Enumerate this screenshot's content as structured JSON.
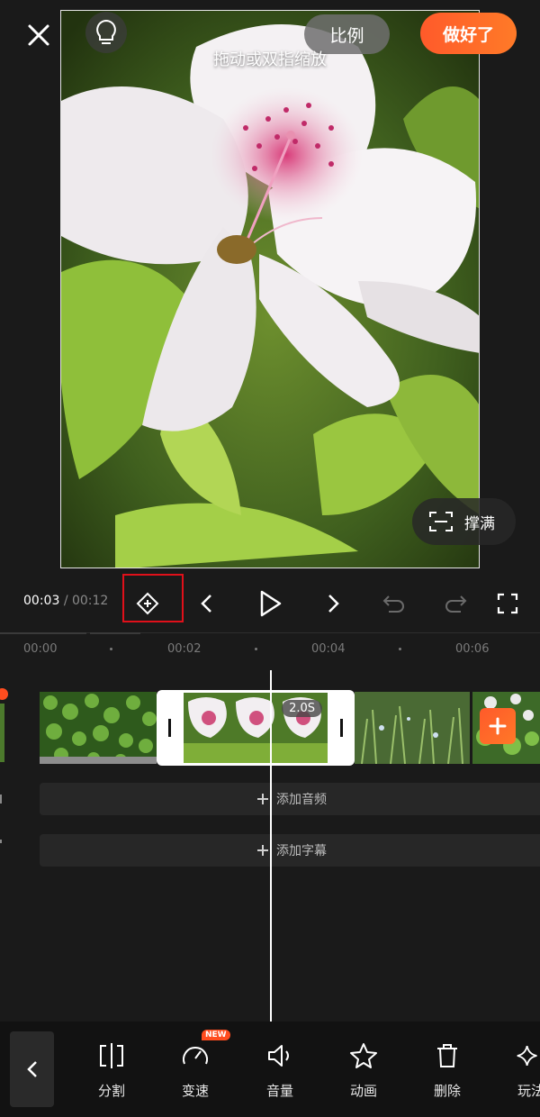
{
  "preview": {
    "hint": "拖动或双指缩放",
    "ratio_label": "比例",
    "done_label": "做好了",
    "fill_label": "撑满"
  },
  "controls": {
    "current_time": "00:03",
    "separator": "/",
    "total_time": "00:12"
  },
  "ruler": {
    "labels": [
      "00:00",
      "00:02",
      "00:04",
      "00:06"
    ]
  },
  "timeline": {
    "selected_clip_duration": "2.0S",
    "add_audio_label": "添加音频",
    "add_subtitle_label": "添加字幕"
  },
  "toolbar": {
    "new_badge": "NEW",
    "items": [
      {
        "label": "分割",
        "icon": "split-icon"
      },
      {
        "label": "变速",
        "icon": "speed-icon"
      },
      {
        "label": "音量",
        "icon": "volume-icon"
      },
      {
        "label": "动画",
        "icon": "star-icon"
      },
      {
        "label": "删除",
        "icon": "trash-icon"
      },
      {
        "label": "玩法",
        "icon": "sparkle-icon"
      }
    ]
  },
  "colors": {
    "accent": "#ff5a2a",
    "highlight_box": "#e0101a",
    "background": "#1a1a1a"
  }
}
